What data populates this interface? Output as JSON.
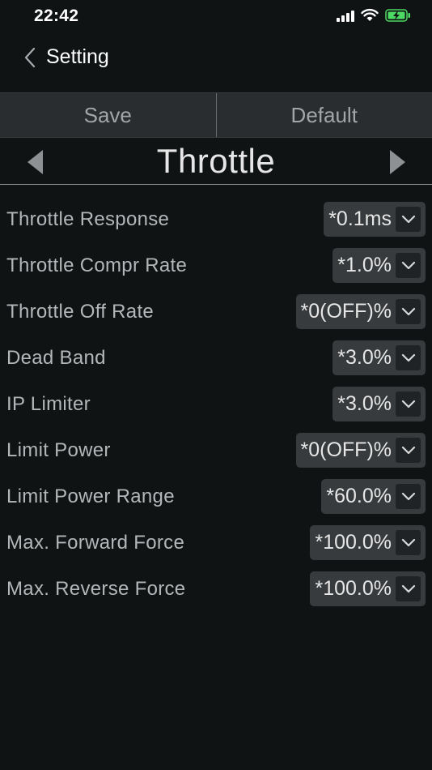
{
  "status": {
    "time": "22:42"
  },
  "nav": {
    "back_icon": "chevron-left-icon",
    "title": "Setting"
  },
  "toolbar": {
    "save_label": "Save",
    "default_label": "Default"
  },
  "section": {
    "title": "Throttle",
    "prev_icon": "triangle-left-icon",
    "next_icon": "triangle-right-icon"
  },
  "settings": [
    {
      "label": "Throttle Response",
      "value": "*0.1ms"
    },
    {
      "label": "Throttle Compr Rate",
      "value": "*1.0%"
    },
    {
      "label": "Throttle Off Rate",
      "value": "*0(OFF)%"
    },
    {
      "label": "Dead Band",
      "value": "*3.0%"
    },
    {
      "label": "IP Limiter",
      "value": "*3.0%"
    },
    {
      "label": "Limit Power",
      "value": "*0(OFF)%"
    },
    {
      "label": "Limit Power Range",
      "value": "*60.0%"
    },
    {
      "label": "Max. Forward Force",
      "value": "*100.0%"
    },
    {
      "label": "Max. Reverse Force",
      "value": "*100.0%"
    }
  ],
  "colors": {
    "background": "#101314",
    "segment_bg": "#2a2d2f",
    "dropdown_bg": "#383b3d",
    "battery": "#4cd964"
  }
}
